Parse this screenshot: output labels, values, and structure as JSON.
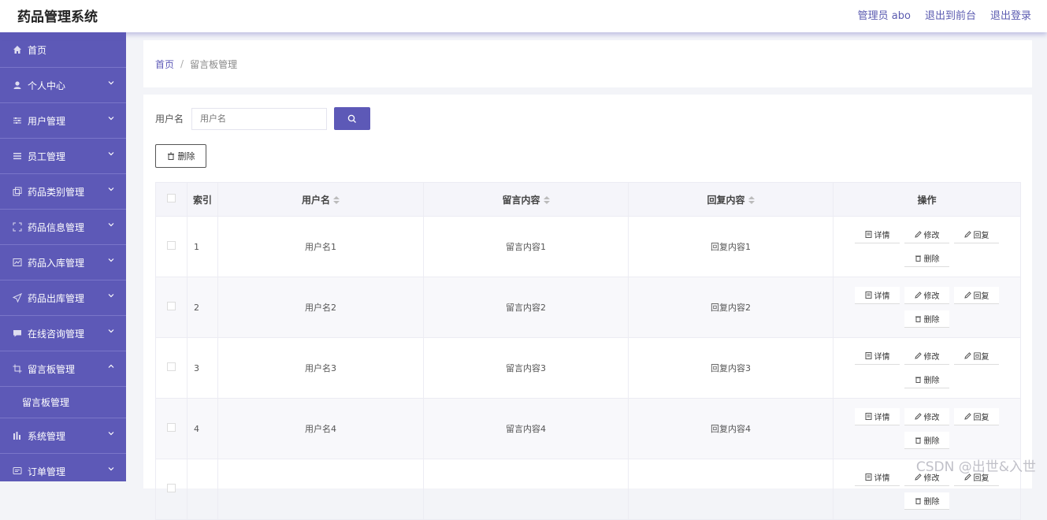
{
  "app": {
    "title": "药品管理系统"
  },
  "top_links": {
    "admin": "管理员 abo",
    "to_front": "退出到前台",
    "logout": "退出登录"
  },
  "sidebar": {
    "items": [
      {
        "label": "首页",
        "icon": "home-icon",
        "chevron": false
      },
      {
        "label": "个人中心",
        "icon": "user-icon",
        "chevron": true
      },
      {
        "label": "用户管理",
        "icon": "sliders-icon",
        "chevron": true
      },
      {
        "label": "员工管理",
        "icon": "list-icon",
        "chevron": true
      },
      {
        "label": "药品类别管理",
        "icon": "copy-icon",
        "chevron": true
      },
      {
        "label": "药品信息管理",
        "icon": "frame-icon",
        "chevron": true
      },
      {
        "label": "药品入库管理",
        "icon": "chart-icon",
        "chevron": true
      },
      {
        "label": "药品出库管理",
        "icon": "send-icon",
        "chevron": true
      },
      {
        "label": "在线咨询管理",
        "icon": "chat-icon",
        "chevron": true
      },
      {
        "label": "留言板管理",
        "icon": "crop-icon",
        "chevron": "up"
      }
    ],
    "sub_item": "留言板管理",
    "after_items": [
      {
        "label": "系统管理",
        "icon": "bars-icon",
        "chevron": true
      },
      {
        "label": "订单管理",
        "icon": "message-icon",
        "chevron": true
      }
    ]
  },
  "breadcrumb": {
    "home": "首页",
    "sep": "/",
    "current": "留言板管理"
  },
  "search": {
    "label": "用户名",
    "placeholder": "用户名"
  },
  "delete_button": "删除",
  "table": {
    "headers": {
      "index": "索引",
      "username": "用户名",
      "content": "留言内容",
      "reply": "回复内容",
      "actions": "操作"
    },
    "rows": [
      {
        "index": "1",
        "username": "用户名1",
        "content": "留言内容1",
        "reply": "回复内容1"
      },
      {
        "index": "2",
        "username": "用户名2",
        "content": "留言内容2",
        "reply": "回复内容2"
      },
      {
        "index": "3",
        "username": "用户名3",
        "content": "留言内容3",
        "reply": "回复内容3"
      },
      {
        "index": "4",
        "username": "用户名4",
        "content": "留言内容4",
        "reply": "回复内容4"
      },
      {
        "index": "",
        "username": "",
        "content": "",
        "reply": ""
      }
    ],
    "actions": {
      "detail": "详情",
      "edit": "修改",
      "reply": "回复",
      "delete": "删除"
    }
  },
  "watermark": "CSDN @出世&入世",
  "colors": {
    "primary": "#5d59b7",
    "background": "#f3f4f8"
  }
}
